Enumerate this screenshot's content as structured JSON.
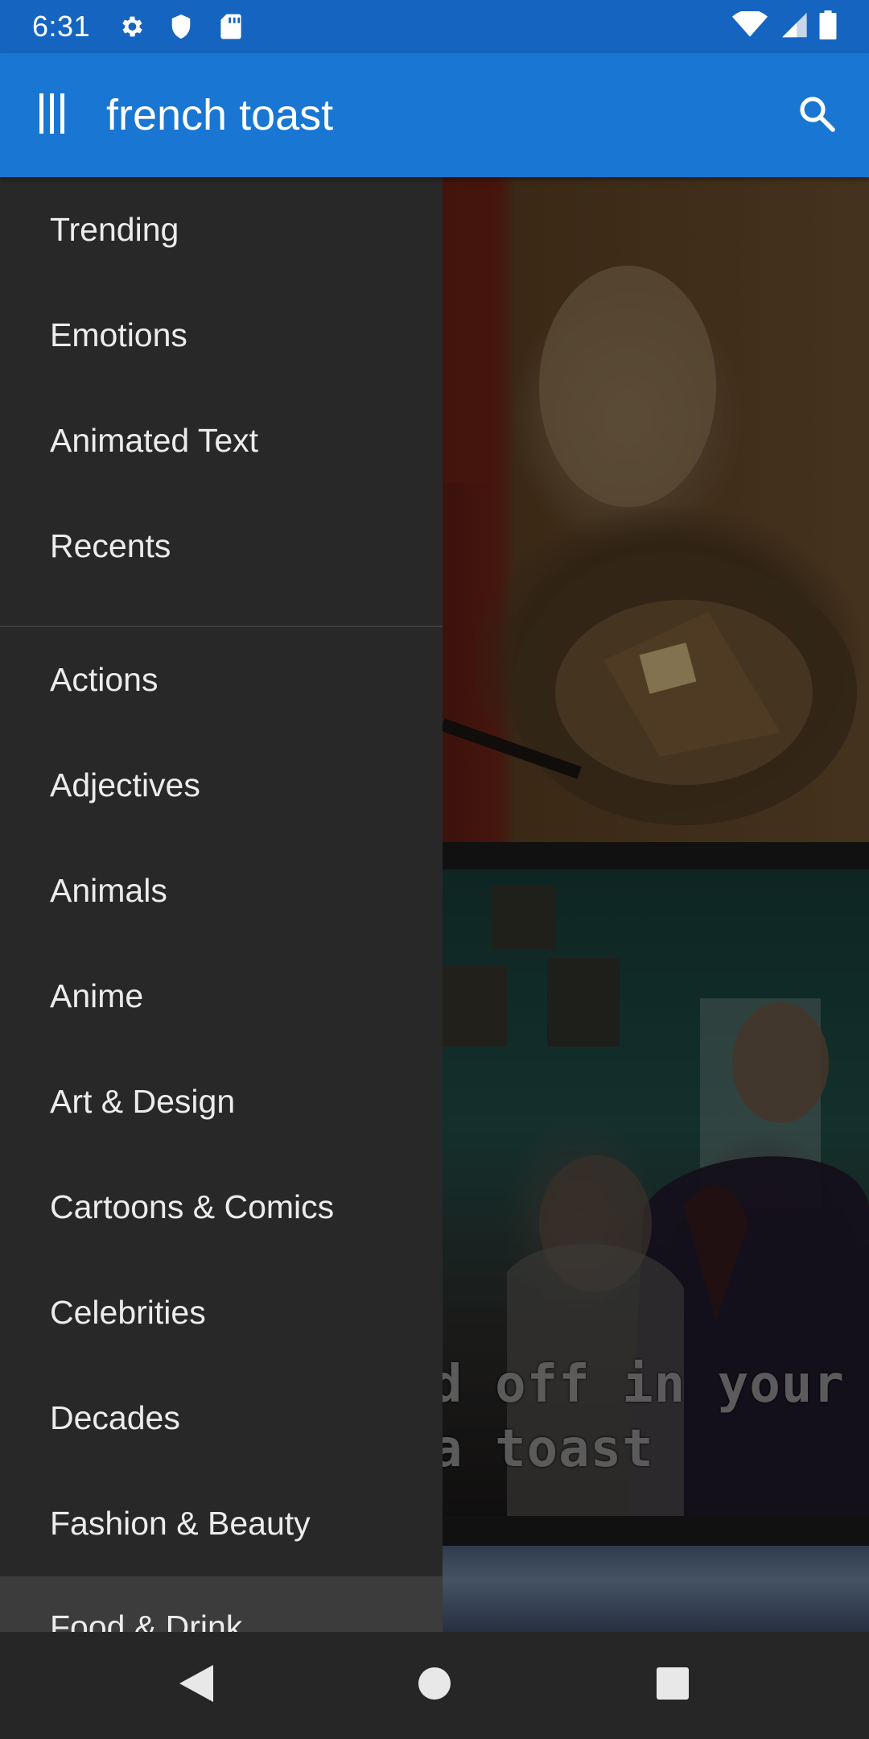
{
  "status_bar": {
    "time": "6:31",
    "left_icons": [
      "gear-icon",
      "shield-icon",
      "sd-card-icon"
    ],
    "right_icons": [
      "wifi-icon",
      "cell-signal-icon",
      "battery-icon"
    ]
  },
  "app_bar": {
    "menu_icon": "menu-icon",
    "search_query": "french toast",
    "search_icon": "search-icon",
    "color": "#1976d2",
    "status_color": "#1565c0"
  },
  "drawer": {
    "primary_items": [
      {
        "label": "Trending"
      },
      {
        "label": "Emotions"
      },
      {
        "label": "Animated Text"
      },
      {
        "label": "Recents"
      }
    ],
    "category_items": [
      {
        "label": "Actions"
      },
      {
        "label": "Adjectives"
      },
      {
        "label": "Animals"
      },
      {
        "label": "Anime"
      },
      {
        "label": "Art & Design"
      },
      {
        "label": "Cartoons & Comics"
      },
      {
        "label": "Celebrities"
      },
      {
        "label": "Decades"
      },
      {
        "label": "Fashion & Beauty"
      },
      {
        "label": "Food & Drink",
        "selected": true
      }
    ],
    "background": "#282828",
    "selected_background": "#3c3c3c"
  },
  "content": {
    "gif_caption_line1": "d off in your",
    "gif_caption_line2": "a toast"
  },
  "nav_bar": {
    "buttons": [
      "back-icon",
      "home-icon",
      "recents-icon"
    ]
  }
}
